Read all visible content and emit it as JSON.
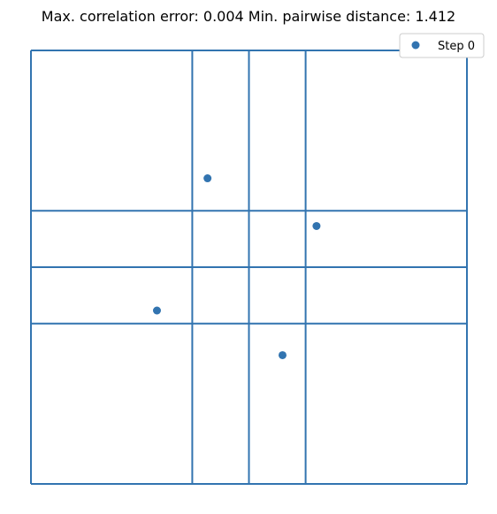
{
  "chart_data": {
    "type": "scatter",
    "title": "Max. correlation error: 0.004 Min. pairwise distance: 1.412",
    "xlabel": "",
    "ylabel": "",
    "axes_visible": false,
    "grid": false,
    "legend": {
      "location": "top-right",
      "entries": [
        "Step 0"
      ]
    },
    "series": [
      {
        "name": "Step 0",
        "color": "#3274b0",
        "marker": "circle",
        "points": [
          {
            "x": 0.405,
            "y": 0.705
          },
          {
            "x": 0.655,
            "y": 0.595
          },
          {
            "x": 0.289,
            "y": 0.4
          },
          {
            "x": 0.577,
            "y": 0.297
          }
        ]
      }
    ],
    "boundaries": {
      "color": "#3274b0",
      "x": [
        0.0,
        0.37,
        0.5,
        0.63,
        1.0
      ],
      "y": [
        0.0,
        0.37,
        0.5,
        0.63,
        1.0
      ]
    },
    "xlim": [
      0,
      1
    ],
    "ylim": [
      0,
      1
    ]
  }
}
